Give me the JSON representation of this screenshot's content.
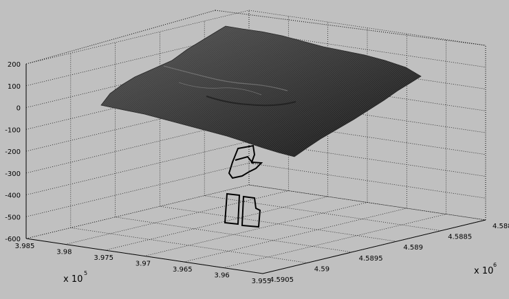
{
  "chart_data": {
    "type": "surface",
    "title": "",
    "xlabel": "",
    "ylabel": "",
    "zlabel": "",
    "grid": true,
    "background": "#c0c0c0",
    "x_axis": {
      "exponent_label": "x 10",
      "exponent_power": "5",
      "lim": [
        3.955,
        3.985
      ],
      "ticks": [
        3.985,
        3.98,
        3.975,
        3.97,
        3.965,
        3.96,
        3.955
      ],
      "tick_labels": [
        "3.985",
        "3.98",
        "3.975",
        "3.97",
        "3.965",
        "3.96",
        "3.955"
      ]
    },
    "y_axis": {
      "exponent_label": "x 10",
      "exponent_power": "6",
      "lim": [
        4.588,
        4.5905
      ],
      "ticks": [
        4.588,
        4.5885,
        4.589,
        4.5895,
        4.59,
        4.5905
      ],
      "tick_labels": [
        "4.588",
        "4.5885",
        "4.589",
        "4.5895",
        "4.59",
        "4.5905"
      ]
    },
    "z_axis": {
      "lim": [
        -600,
        200
      ],
      "ticks": [
        200,
        100,
        0,
        -100,
        -200,
        -300,
        -400,
        -500,
        -600
      ],
      "tick_labels": [
        "200",
        "100",
        "0",
        "-100",
        "-200",
        "-300",
        "-400",
        "-500",
        "-600"
      ]
    },
    "surface": {
      "description": "terrain mesh",
      "z_range_approx": [
        -220,
        170
      ],
      "color": "#3a3a3a"
    },
    "outlines": [
      {
        "name": "upper-outline",
        "z_approx": -250
      },
      {
        "name": "lower-outline",
        "z_approx": -450
      }
    ]
  }
}
